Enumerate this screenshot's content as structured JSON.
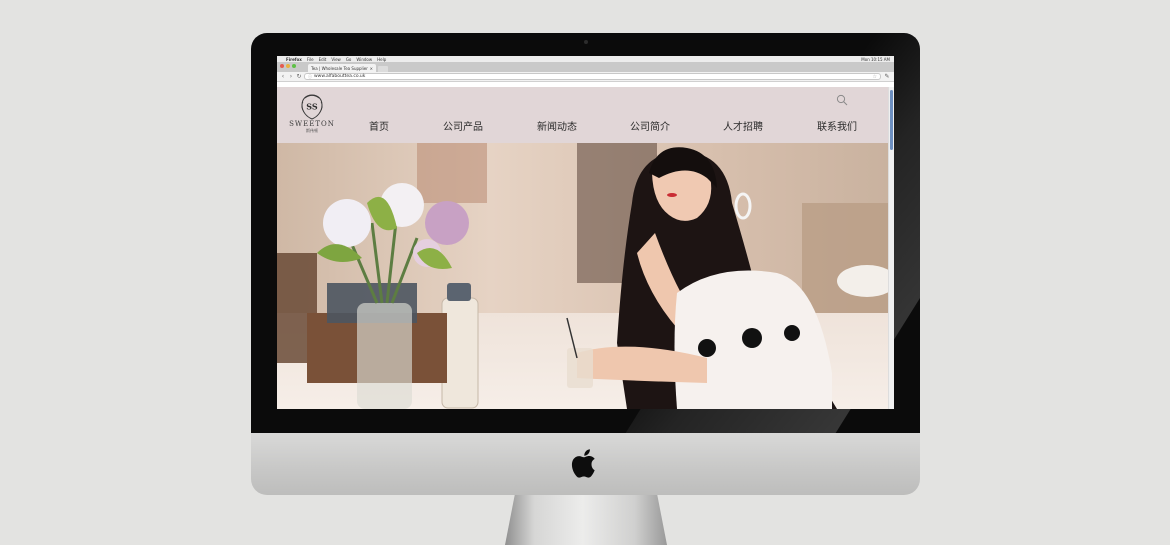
{
  "system_menubar": {
    "apple": "",
    "items": [
      "Firefox",
      "File",
      "Edit",
      "View",
      "Go",
      "Window",
      "Help"
    ],
    "clock": "Mon 10:15 AM"
  },
  "browser": {
    "tab_title": "Tea | Wholesale Tea Supplier",
    "tab_close": "×",
    "url": "www.alfabouttea.co.uk",
    "back_icon": "arrow-left-icon",
    "forward_icon": "arrow-right-icon",
    "reload_icon": "reload-icon"
  },
  "site": {
    "logo_monogram": "SS",
    "logo_word": "SWEETON",
    "logo_sub": "斯伟顿",
    "nav": [
      "首页",
      "公司产品",
      "新闻动态",
      "公司简介",
      "人才招聘",
      "联系我们"
    ],
    "header_bg": "#e1d6d7"
  },
  "device": {
    "frame_color": "#0b0b0b",
    "chin_color": "#cbcbca"
  }
}
